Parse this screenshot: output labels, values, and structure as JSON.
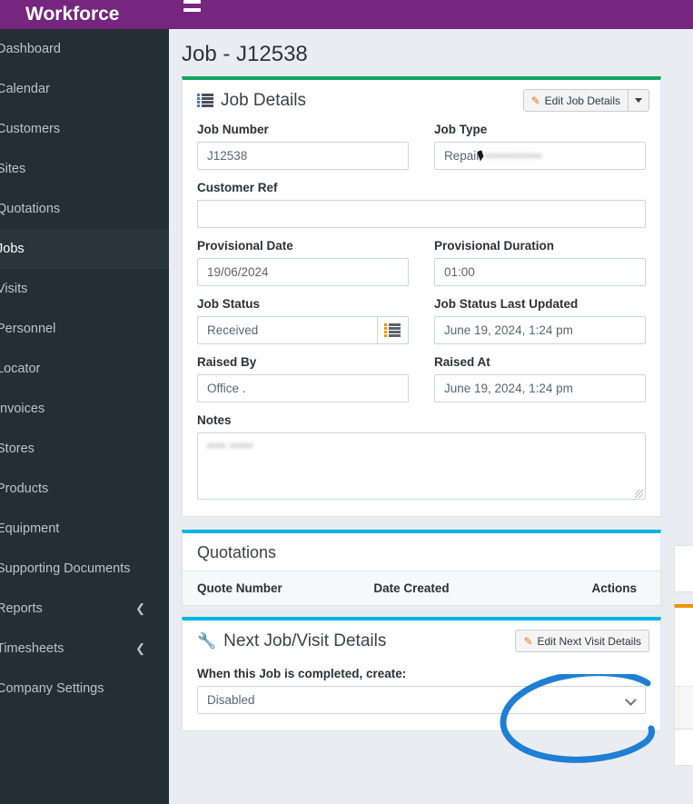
{
  "brand": {
    "title": "Workforce",
    "color": "#76267f"
  },
  "sidebar": {
    "bg": "#232f34",
    "items": [
      {
        "label": "Dashboard",
        "active": false,
        "chevron": ""
      },
      {
        "label": "Calendar",
        "active": false,
        "chevron": ""
      },
      {
        "label": "Customers",
        "active": false,
        "chevron": ""
      },
      {
        "label": "Sites",
        "active": false,
        "chevron": ""
      },
      {
        "label": "Quotations",
        "active": false,
        "chevron": ""
      },
      {
        "label": "Jobs",
        "active": true,
        "chevron": ""
      },
      {
        "label": "Visits",
        "active": false,
        "chevron": ""
      },
      {
        "label": "Personnel",
        "active": false,
        "chevron": ""
      },
      {
        "label": "Locator",
        "active": false,
        "chevron": ""
      },
      {
        "label": "Invoices",
        "active": false,
        "chevron": ""
      },
      {
        "label": "Stores",
        "active": false,
        "chevron": ""
      },
      {
        "label": "Products",
        "active": false,
        "chevron": ""
      },
      {
        "label": "Equipment",
        "active": false,
        "chevron": ""
      },
      {
        "label": "Supporting Documents",
        "active": false,
        "chevron": ""
      },
      {
        "label": "Reports",
        "active": false,
        "chevron": "❮"
      },
      {
        "label": "Timesheets",
        "active": false,
        "chevron": "❮"
      },
      {
        "label": "Company Settings",
        "active": false,
        "chevron": ""
      }
    ]
  },
  "topbar": {
    "menu_icon": "hamburger-icon"
  },
  "page": {
    "title": "Job - J12538"
  },
  "job_details": {
    "accent_color": "#0fa85e",
    "heading": "Job Details",
    "heading_icon": "list-icon",
    "edit_button": {
      "label": "Edit Job Details",
      "icon": "pencil-icon",
      "split_icon": "caret-down-icon"
    },
    "fields": {
      "job_number": {
        "label": "Job Number",
        "value": "J12538"
      },
      "job_type": {
        "label": "Job Type",
        "value": "Repair",
        "redacted_suffix": "••••••••••••"
      },
      "customer_ref": {
        "label": "Customer Ref",
        "value": ""
      },
      "prov_date": {
        "label": "Provisional Date",
        "value": "19/06/2024"
      },
      "prov_dur": {
        "label": "Provisional Duration",
        "value": "01:00"
      },
      "job_status": {
        "label": "Job Status",
        "value": "Received",
        "addon_icon": "list-picker-icon"
      },
      "status_upd": {
        "label": "Job Status Last Updated",
        "value": "June 19, 2024, 1:24 pm"
      },
      "raised_by": {
        "label": "Raised By",
        "value": "Office ."
      },
      "raised_at": {
        "label": "Raised At",
        "value": "June 19, 2024, 1:24 pm"
      },
      "notes": {
        "label": "Notes",
        "value": "",
        "redacted_text": "•••• •••••"
      }
    }
  },
  "quotations": {
    "accent_color": "#00b5e2",
    "heading": "Quotations",
    "columns": [
      "Quote Number",
      "Date Created",
      "Actions"
    ],
    "rows": []
  },
  "next_visit": {
    "accent_color": "#00b5e2",
    "heading": "Next Job/Visit Details",
    "heading_icon": "wrench-icon",
    "edit_button": {
      "label": "Edit Next Visit Details",
      "icon": "pencil-icon"
    },
    "create_field": {
      "label": "When this Job is completed, create:",
      "value": "Disabled",
      "options": [
        "Disabled"
      ]
    }
  },
  "annotation": {
    "type": "hand-drawn-circle",
    "color": "#1e7fd4",
    "targets": "Edit Next Visit Details"
  },
  "right_column": {
    "accent_color": "#ef9400"
  }
}
